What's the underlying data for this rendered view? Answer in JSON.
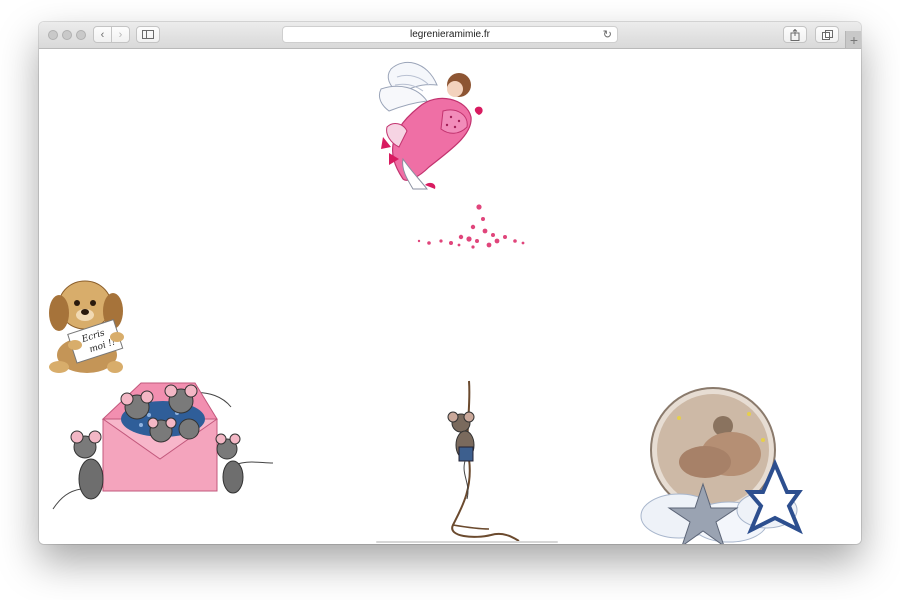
{
  "browser": {
    "url": "legrenieramimie.fr",
    "icons": {
      "back": "chevron-left-icon",
      "forward": "chevron-right-icon",
      "sidebar": "sidebar-icon",
      "reload": "reload-icon",
      "share": "share-icon",
      "tabs": "tabs-overview-icon",
      "new_tab": "plus-icon"
    }
  },
  "page": {
    "images": [
      {
        "name": "angel-image",
        "desc": "pink angel"
      },
      {
        "name": "hearts-image",
        "desc": "falling hearts"
      },
      {
        "name": "puppy-image",
        "desc": "puppy holding note"
      },
      {
        "name": "mice-envelope-image",
        "desc": "mice in pink envelope"
      },
      {
        "name": "mouse-rope-image",
        "desc": "mouse climbing rope"
      },
      {
        "name": "baby-moon-image",
        "desc": "sleeping baby with stars"
      }
    ],
    "puppy_note": {
      "line1": "Ecris",
      "line2": "moi !!"
    }
  }
}
